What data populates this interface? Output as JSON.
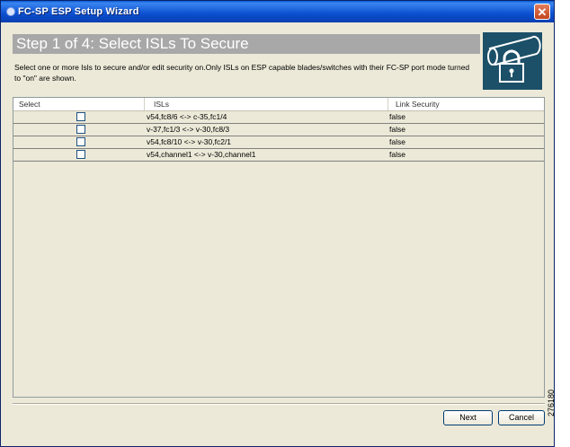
{
  "window": {
    "title": "FC-SP ESP Setup Wizard",
    "close_glyph": "✕"
  },
  "header": {
    "step_title": "Step 1 of 4: Select ISLs To Secure",
    "icon": "lock-icon"
  },
  "description": "Select one or more Isls to secure and/or edit security on.Only ISLs on ESP capable blades/switches with their FC-SP port mode turned to \"on\" are shown.",
  "table": {
    "columns": [
      "Select",
      "ISLs",
      "Link Security"
    ],
    "rows": [
      {
        "checked": false,
        "isl": "v54,fc8/6 <-> c-35,fc1/4",
        "link_security": "false"
      },
      {
        "checked": false,
        "isl": "v-37,fc1/3 <-> v-30,fc8/3",
        "link_security": "false"
      },
      {
        "checked": false,
        "isl": "v54,fc8/10 <-> v-30,fc2/1",
        "link_security": "false"
      },
      {
        "checked": false,
        "isl": "v54,channel1 <-> v-30,channel1",
        "link_security": "false"
      }
    ]
  },
  "buttons": {
    "next": "Next",
    "cancel": "Cancel"
  },
  "figure_id": "276180"
}
